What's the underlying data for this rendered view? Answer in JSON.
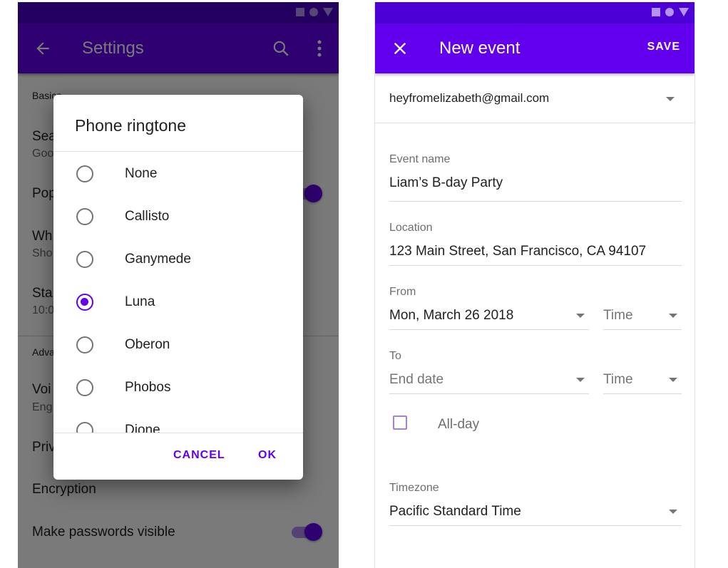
{
  "left_screen": {
    "app_bar": {
      "title": "Settings",
      "back_icon": "arrow-left-icon",
      "search_icon": "search-icon",
      "more_icon": "more-vert-icon"
    },
    "settings": {
      "basics_header": "Basics",
      "items": [
        {
          "title": "Sea",
          "subtitle": "Goo"
        },
        {
          "title": "Pop",
          "subtitle": ""
        },
        {
          "title": "Wh",
          "subtitle": "Sho"
        },
        {
          "title": "Sta",
          "subtitle": "10:0"
        }
      ],
      "advanced_header": "Adva",
      "advanced_items": [
        {
          "title": "Voi",
          "subtitle": "Eng"
        },
        {
          "title": "Priv",
          "subtitle": ""
        },
        {
          "title": "Encryption",
          "subtitle": ""
        },
        {
          "title": "Make passwords visible",
          "subtitle": ""
        }
      ],
      "toggles": {
        "popup": true,
        "make_passwords_visible": true
      }
    },
    "dialog": {
      "title": "Phone ringtone",
      "options": [
        {
          "label": "None",
          "selected": false
        },
        {
          "label": "Callisto",
          "selected": false
        },
        {
          "label": "Ganymede",
          "selected": false
        },
        {
          "label": "Luna",
          "selected": true
        },
        {
          "label": "Oberon",
          "selected": false
        },
        {
          "label": "Phobos",
          "selected": false
        },
        {
          "label": "Dione",
          "selected": false
        }
      ],
      "cancel_label": "CANCEL",
      "ok_label": "OK"
    }
  },
  "right_screen": {
    "app_bar": {
      "title": "New event",
      "close_icon": "close-icon",
      "save_label": "SAVE"
    },
    "account": "heyfromelizabeth@gmail.com",
    "event_name": {
      "label": "Event name",
      "value": "Liam’s B-day Party"
    },
    "location": {
      "label": "Location",
      "value": "123 Main Street, San Francisco, CA 94107"
    },
    "from": {
      "label": "From",
      "date": "Mon, March 26 2018",
      "time_placeholder": "Time"
    },
    "to": {
      "label": "To",
      "date_placeholder": "End date",
      "time_placeholder": "Time"
    },
    "all_day": {
      "label": "All-day",
      "checked": false
    },
    "timezone": {
      "label": "Timezone",
      "value": "Pacific Standard Time"
    }
  },
  "colors": {
    "primary": "#6200ee",
    "primary_dark": "#4a00c8",
    "text_primary": "#212121",
    "text_secondary": "#6e6e6e"
  }
}
